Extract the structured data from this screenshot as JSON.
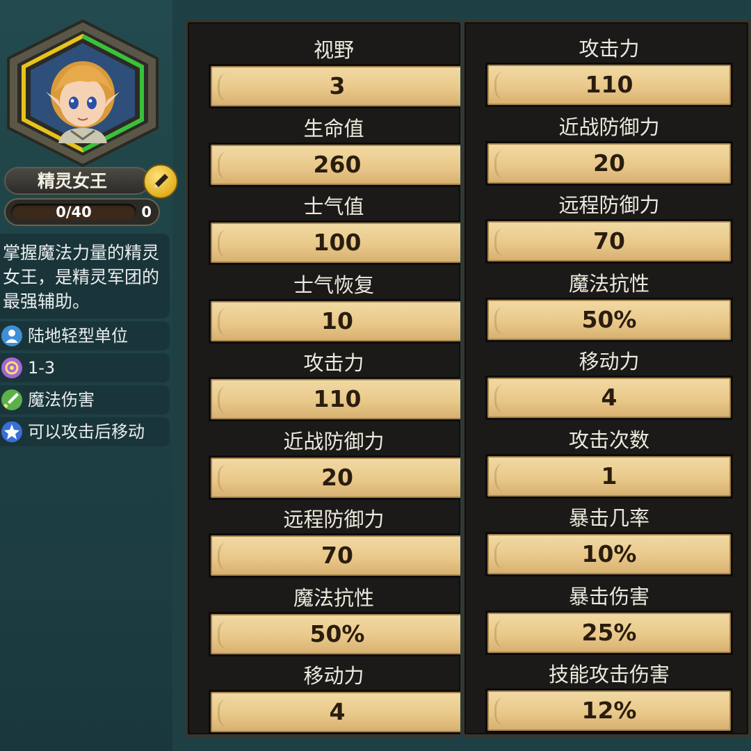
{
  "unit": {
    "name": "精灵女王",
    "xp": "0/40",
    "level": "0",
    "description": "掌握魔法力量的精灵女王，是精灵军团的最强辅助。",
    "traits": [
      {
        "icon": "person-icon",
        "label": "陆地轻型单位",
        "color": "#3f8fd8"
      },
      {
        "icon": "target-icon",
        "label": "1-3",
        "color": "#a866d4"
      },
      {
        "icon": "magic-sword-icon",
        "label": "魔法伤害",
        "color": "#5bb04a"
      },
      {
        "icon": "move-after-attack-icon",
        "label": "可以攻击后移动",
        "color": "#3a6fd8"
      }
    ]
  },
  "stats_left": [
    {
      "label": "视野",
      "value": "3"
    },
    {
      "label": "生命值",
      "value": "260"
    },
    {
      "label": "士气值",
      "value": "100"
    },
    {
      "label": "士气恢复",
      "value": "10"
    },
    {
      "label": "攻击力",
      "value": "110"
    },
    {
      "label": "近战防御力",
      "value": "20"
    },
    {
      "label": "远程防御力",
      "value": "70"
    },
    {
      "label": "魔法抗性",
      "value": "50%"
    },
    {
      "label": "移动力",
      "value": "4"
    }
  ],
  "stats_right": [
    {
      "label": "攻击力",
      "value": "110"
    },
    {
      "label": "近战防御力",
      "value": "20"
    },
    {
      "label": "远程防御力",
      "value": "70"
    },
    {
      "label": "魔法抗性",
      "value": "50%"
    },
    {
      "label": "移动力",
      "value": "4"
    },
    {
      "label": "攻击次数",
      "value": "1"
    },
    {
      "label": "暴击几率",
      "value": "10%"
    },
    {
      "label": "暴击伤害",
      "value": "25%"
    },
    {
      "label": "技能攻击伤害",
      "value": "12%"
    }
  ]
}
